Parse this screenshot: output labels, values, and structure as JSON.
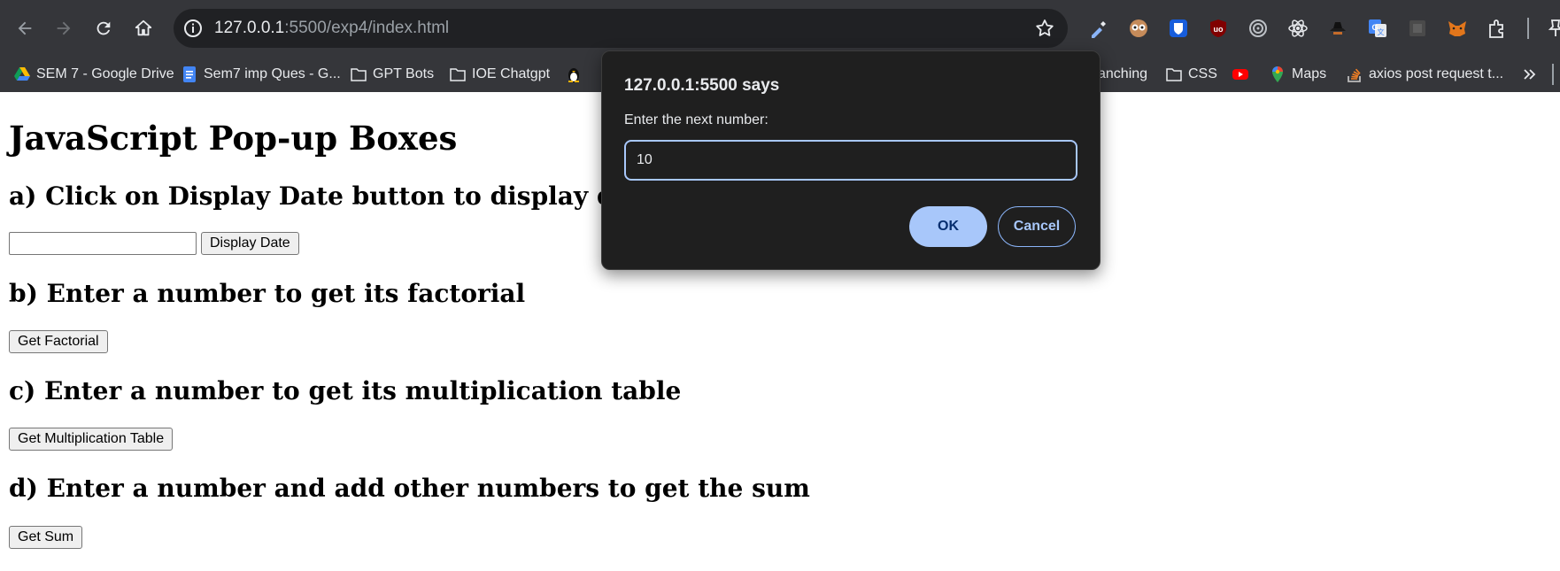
{
  "browser": {
    "url_host": "127.0.0.1",
    "url_rest": ":5500/exp4/index.html",
    "bookmarks": [
      {
        "label": "SEM 7 - Google Drive",
        "icon": "google-drive-icon"
      },
      {
        "label": "Sem7 imp Ques - G...",
        "icon": "google-docs-icon"
      },
      {
        "label": "GPT Bots",
        "icon": "folder-icon"
      },
      {
        "label": "IOE Chatgpt",
        "icon": "folder-icon"
      },
      {
        "label": "",
        "icon": "linux-penguin-icon"
      },
      {
        "label": "anching",
        "icon": ""
      },
      {
        "label": "CSS",
        "icon": "folder-icon"
      },
      {
        "label": "",
        "icon": "youtube-icon"
      },
      {
        "label": "Maps",
        "icon": "google-maps-icon"
      },
      {
        "label": "axios post request t...",
        "icon": "stackoverflow-icon"
      }
    ],
    "extensions": [
      "eyedropper-icon",
      "owl-icon",
      "bitwarden-icon",
      "ublock-origin-icon",
      "target-icon",
      "react-devtools-icon",
      "spy-hat-icon",
      "google-translate-icon",
      "gray-square-icon",
      "metamask-fox-icon",
      "puzzle-icon"
    ],
    "colors": {
      "toolbar": "#35363a",
      "omnibox": "#202124"
    }
  },
  "page": {
    "title": "JavaScript Pop-up Boxes",
    "section_a": "a) Click on Display Date button to display date in the",
    "display_date_button": "Display Date",
    "section_b": "b) Enter a number to get its factorial",
    "factorial_button": "Get Factorial",
    "section_c": "c) Enter a number to get its multiplication table",
    "multiplication_button": "Get Multiplication Table",
    "section_d": "d) Enter a number and add other numbers to get the sum",
    "sum_button": "Get Sum"
  },
  "dialog": {
    "title": "127.0.0.1:5500 says",
    "message": "Enter the next number:",
    "input_value": "10",
    "ok_label": "OK",
    "cancel_label": "Cancel",
    "colors": {
      "background": "#1f1f1f",
      "ok": "#a8c7fa",
      "focus": "#a8c7fa"
    }
  }
}
